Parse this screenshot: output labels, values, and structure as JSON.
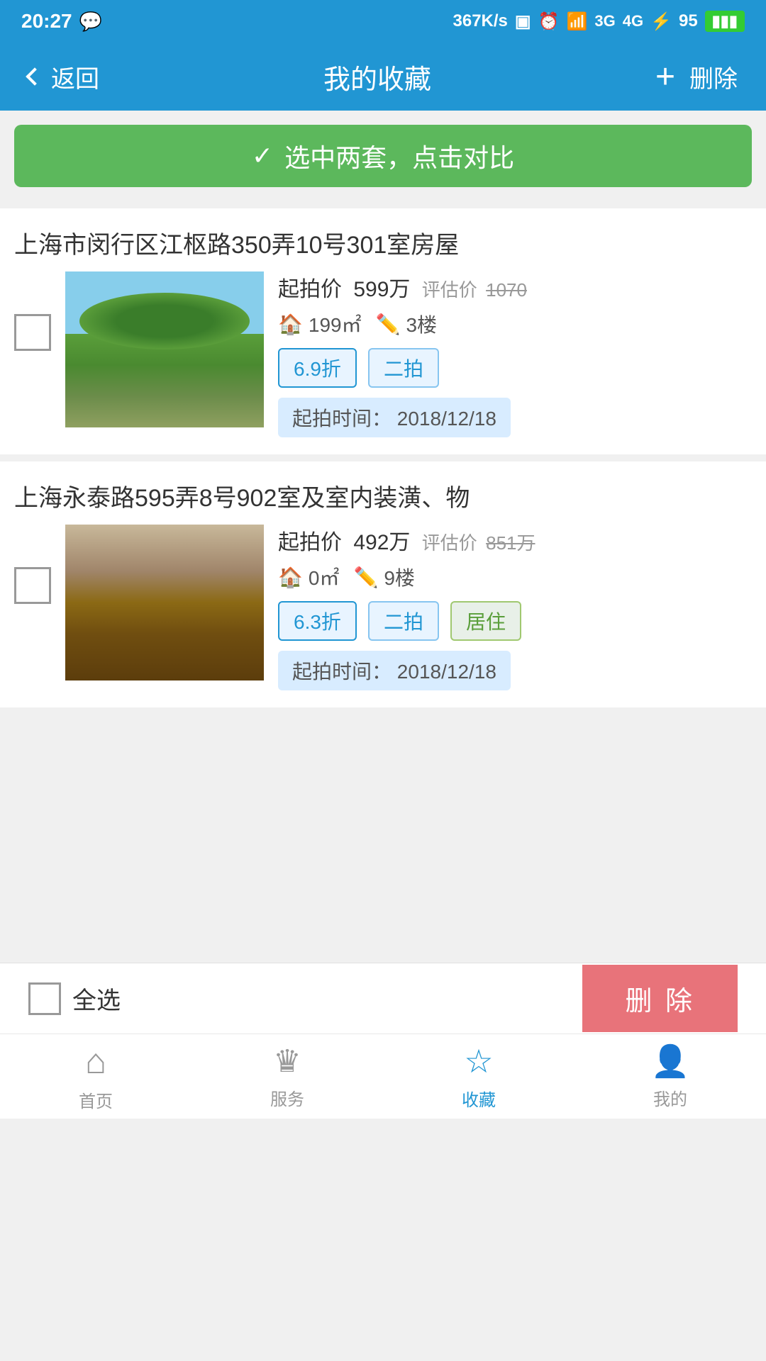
{
  "status": {
    "time": "20:27",
    "network": "367K/s",
    "battery": "95"
  },
  "header": {
    "back_label": "返回",
    "title": "我的收藏",
    "add_label": "+",
    "delete_label": "删除"
  },
  "compare_banner": {
    "icon": "✓",
    "label": "选中两套，点击对比"
  },
  "properties": [
    {
      "title": "上海市闵行区江枢路350弄10号301室房屋",
      "start_price_label": "起拍价",
      "start_price": "599万",
      "eval_label": "评估价",
      "eval_price": "1070",
      "area": "199㎡",
      "floor": "3楼",
      "discount": "6.9折",
      "round": "二拍",
      "type": "",
      "date_label": "起拍时间：",
      "date": "2018/12/18"
    },
    {
      "title": "上海永泰路595弄8号902室及室内装潢、物",
      "start_price_label": "起拍价",
      "start_price": "492万",
      "eval_label": "评估价",
      "eval_price": "851万",
      "area": "0㎡",
      "floor": "9楼",
      "discount": "6.3折",
      "round": "二拍",
      "type": "居住",
      "date_label": "起拍时间：",
      "date": "2018/12/18"
    }
  ],
  "bottom_action": {
    "select_all_label": "全选",
    "delete_label": "删 除"
  },
  "bottom_nav": {
    "items": [
      {
        "label": "首页",
        "icon": "⌂",
        "active": false
      },
      {
        "label": "服务",
        "icon": "♛",
        "active": false
      },
      {
        "label": "收藏",
        "icon": "☆",
        "active": true
      },
      {
        "label": "我的",
        "icon": "👤",
        "active": false
      }
    ]
  }
}
